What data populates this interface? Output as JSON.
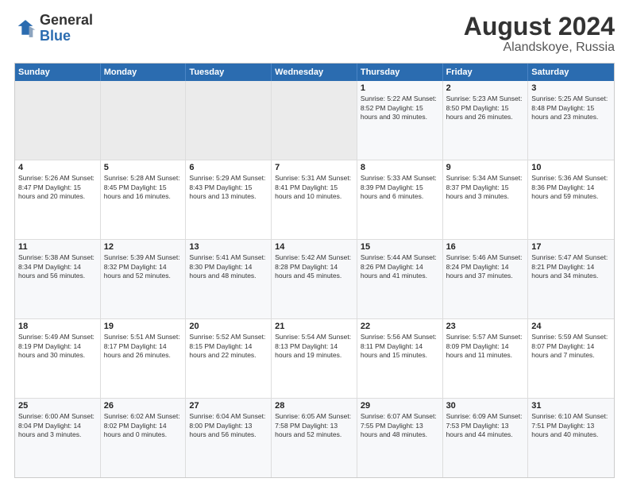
{
  "header": {
    "logo_general": "General",
    "logo_blue": "Blue",
    "month_year": "August 2024",
    "location": "Alandskoye, Russia"
  },
  "days_of_week": [
    "Sunday",
    "Monday",
    "Tuesday",
    "Wednesday",
    "Thursday",
    "Friday",
    "Saturday"
  ],
  "weeks": [
    [
      {
        "day": "",
        "info": ""
      },
      {
        "day": "",
        "info": ""
      },
      {
        "day": "",
        "info": ""
      },
      {
        "day": "",
        "info": ""
      },
      {
        "day": "1",
        "info": "Sunrise: 5:22 AM\nSunset: 8:52 PM\nDaylight: 15 hours\nand 30 minutes."
      },
      {
        "day": "2",
        "info": "Sunrise: 5:23 AM\nSunset: 8:50 PM\nDaylight: 15 hours\nand 26 minutes."
      },
      {
        "day": "3",
        "info": "Sunrise: 5:25 AM\nSunset: 8:48 PM\nDaylight: 15 hours\nand 23 minutes."
      }
    ],
    [
      {
        "day": "4",
        "info": "Sunrise: 5:26 AM\nSunset: 8:47 PM\nDaylight: 15 hours\nand 20 minutes."
      },
      {
        "day": "5",
        "info": "Sunrise: 5:28 AM\nSunset: 8:45 PM\nDaylight: 15 hours\nand 16 minutes."
      },
      {
        "day": "6",
        "info": "Sunrise: 5:29 AM\nSunset: 8:43 PM\nDaylight: 15 hours\nand 13 minutes."
      },
      {
        "day": "7",
        "info": "Sunrise: 5:31 AM\nSunset: 8:41 PM\nDaylight: 15 hours\nand 10 minutes."
      },
      {
        "day": "8",
        "info": "Sunrise: 5:33 AM\nSunset: 8:39 PM\nDaylight: 15 hours\nand 6 minutes."
      },
      {
        "day": "9",
        "info": "Sunrise: 5:34 AM\nSunset: 8:37 PM\nDaylight: 15 hours\nand 3 minutes."
      },
      {
        "day": "10",
        "info": "Sunrise: 5:36 AM\nSunset: 8:36 PM\nDaylight: 14 hours\nand 59 minutes."
      }
    ],
    [
      {
        "day": "11",
        "info": "Sunrise: 5:38 AM\nSunset: 8:34 PM\nDaylight: 14 hours\nand 56 minutes."
      },
      {
        "day": "12",
        "info": "Sunrise: 5:39 AM\nSunset: 8:32 PM\nDaylight: 14 hours\nand 52 minutes."
      },
      {
        "day": "13",
        "info": "Sunrise: 5:41 AM\nSunset: 8:30 PM\nDaylight: 14 hours\nand 48 minutes."
      },
      {
        "day": "14",
        "info": "Sunrise: 5:42 AM\nSunset: 8:28 PM\nDaylight: 14 hours\nand 45 minutes."
      },
      {
        "day": "15",
        "info": "Sunrise: 5:44 AM\nSunset: 8:26 PM\nDaylight: 14 hours\nand 41 minutes."
      },
      {
        "day": "16",
        "info": "Sunrise: 5:46 AM\nSunset: 8:24 PM\nDaylight: 14 hours\nand 37 minutes."
      },
      {
        "day": "17",
        "info": "Sunrise: 5:47 AM\nSunset: 8:21 PM\nDaylight: 14 hours\nand 34 minutes."
      }
    ],
    [
      {
        "day": "18",
        "info": "Sunrise: 5:49 AM\nSunset: 8:19 PM\nDaylight: 14 hours\nand 30 minutes."
      },
      {
        "day": "19",
        "info": "Sunrise: 5:51 AM\nSunset: 8:17 PM\nDaylight: 14 hours\nand 26 minutes."
      },
      {
        "day": "20",
        "info": "Sunrise: 5:52 AM\nSunset: 8:15 PM\nDaylight: 14 hours\nand 22 minutes."
      },
      {
        "day": "21",
        "info": "Sunrise: 5:54 AM\nSunset: 8:13 PM\nDaylight: 14 hours\nand 19 minutes."
      },
      {
        "day": "22",
        "info": "Sunrise: 5:56 AM\nSunset: 8:11 PM\nDaylight: 14 hours\nand 15 minutes."
      },
      {
        "day": "23",
        "info": "Sunrise: 5:57 AM\nSunset: 8:09 PM\nDaylight: 14 hours\nand 11 minutes."
      },
      {
        "day": "24",
        "info": "Sunrise: 5:59 AM\nSunset: 8:07 PM\nDaylight: 14 hours\nand 7 minutes."
      }
    ],
    [
      {
        "day": "25",
        "info": "Sunrise: 6:00 AM\nSunset: 8:04 PM\nDaylight: 14 hours\nand 3 minutes."
      },
      {
        "day": "26",
        "info": "Sunrise: 6:02 AM\nSunset: 8:02 PM\nDaylight: 14 hours\nand 0 minutes."
      },
      {
        "day": "27",
        "info": "Sunrise: 6:04 AM\nSunset: 8:00 PM\nDaylight: 13 hours\nand 56 minutes."
      },
      {
        "day": "28",
        "info": "Sunrise: 6:05 AM\nSunset: 7:58 PM\nDaylight: 13 hours\nand 52 minutes."
      },
      {
        "day": "29",
        "info": "Sunrise: 6:07 AM\nSunset: 7:55 PM\nDaylight: 13 hours\nand 48 minutes."
      },
      {
        "day": "30",
        "info": "Sunrise: 6:09 AM\nSunset: 7:53 PM\nDaylight: 13 hours\nand 44 minutes."
      },
      {
        "day": "31",
        "info": "Sunrise: 6:10 AM\nSunset: 7:51 PM\nDaylight: 13 hours\nand 40 minutes."
      }
    ]
  ]
}
